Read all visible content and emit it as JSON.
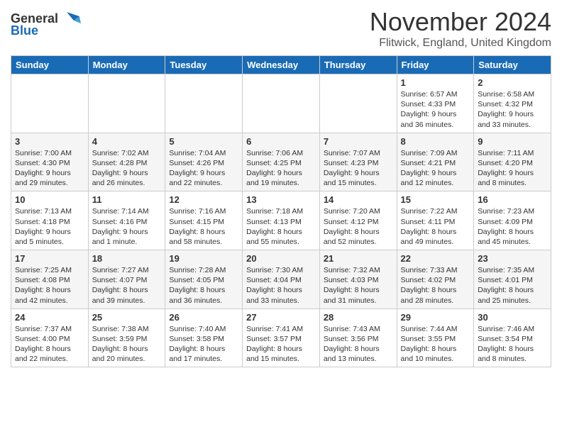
{
  "header": {
    "logo": {
      "general": "General",
      "blue": "Blue"
    },
    "title": "November 2024",
    "location": "Flitwick, England, United Kingdom"
  },
  "weekdays": [
    "Sunday",
    "Monday",
    "Tuesday",
    "Wednesday",
    "Thursday",
    "Friday",
    "Saturday"
  ],
  "weeks": [
    [
      {
        "day": "",
        "info": ""
      },
      {
        "day": "",
        "info": ""
      },
      {
        "day": "",
        "info": ""
      },
      {
        "day": "",
        "info": ""
      },
      {
        "day": "",
        "info": ""
      },
      {
        "day": "1",
        "info": "Sunrise: 6:57 AM\nSunset: 4:33 PM\nDaylight: 9 hours and 36 minutes."
      },
      {
        "day": "2",
        "info": "Sunrise: 6:58 AM\nSunset: 4:32 PM\nDaylight: 9 hours and 33 minutes."
      }
    ],
    [
      {
        "day": "3",
        "info": "Sunrise: 7:00 AM\nSunset: 4:30 PM\nDaylight: 9 hours and 29 minutes."
      },
      {
        "day": "4",
        "info": "Sunrise: 7:02 AM\nSunset: 4:28 PM\nDaylight: 9 hours and 26 minutes."
      },
      {
        "day": "5",
        "info": "Sunrise: 7:04 AM\nSunset: 4:26 PM\nDaylight: 9 hours and 22 minutes."
      },
      {
        "day": "6",
        "info": "Sunrise: 7:06 AM\nSunset: 4:25 PM\nDaylight: 9 hours and 19 minutes."
      },
      {
        "day": "7",
        "info": "Sunrise: 7:07 AM\nSunset: 4:23 PM\nDaylight: 9 hours and 15 minutes."
      },
      {
        "day": "8",
        "info": "Sunrise: 7:09 AM\nSunset: 4:21 PM\nDaylight: 9 hours and 12 minutes."
      },
      {
        "day": "9",
        "info": "Sunrise: 7:11 AM\nSunset: 4:20 PM\nDaylight: 9 hours and 8 minutes."
      }
    ],
    [
      {
        "day": "10",
        "info": "Sunrise: 7:13 AM\nSunset: 4:18 PM\nDaylight: 9 hours and 5 minutes."
      },
      {
        "day": "11",
        "info": "Sunrise: 7:14 AM\nSunset: 4:16 PM\nDaylight: 9 hours and 1 minute."
      },
      {
        "day": "12",
        "info": "Sunrise: 7:16 AM\nSunset: 4:15 PM\nDaylight: 8 hours and 58 minutes."
      },
      {
        "day": "13",
        "info": "Sunrise: 7:18 AM\nSunset: 4:13 PM\nDaylight: 8 hours and 55 minutes."
      },
      {
        "day": "14",
        "info": "Sunrise: 7:20 AM\nSunset: 4:12 PM\nDaylight: 8 hours and 52 minutes."
      },
      {
        "day": "15",
        "info": "Sunrise: 7:22 AM\nSunset: 4:11 PM\nDaylight: 8 hours and 49 minutes."
      },
      {
        "day": "16",
        "info": "Sunrise: 7:23 AM\nSunset: 4:09 PM\nDaylight: 8 hours and 45 minutes."
      }
    ],
    [
      {
        "day": "17",
        "info": "Sunrise: 7:25 AM\nSunset: 4:08 PM\nDaylight: 8 hours and 42 minutes."
      },
      {
        "day": "18",
        "info": "Sunrise: 7:27 AM\nSunset: 4:07 PM\nDaylight: 8 hours and 39 minutes."
      },
      {
        "day": "19",
        "info": "Sunrise: 7:28 AM\nSunset: 4:05 PM\nDaylight: 8 hours and 36 minutes."
      },
      {
        "day": "20",
        "info": "Sunrise: 7:30 AM\nSunset: 4:04 PM\nDaylight: 8 hours and 33 minutes."
      },
      {
        "day": "21",
        "info": "Sunrise: 7:32 AM\nSunset: 4:03 PM\nDaylight: 8 hours and 31 minutes."
      },
      {
        "day": "22",
        "info": "Sunrise: 7:33 AM\nSunset: 4:02 PM\nDaylight: 8 hours and 28 minutes."
      },
      {
        "day": "23",
        "info": "Sunrise: 7:35 AM\nSunset: 4:01 PM\nDaylight: 8 hours and 25 minutes."
      }
    ],
    [
      {
        "day": "24",
        "info": "Sunrise: 7:37 AM\nSunset: 4:00 PM\nDaylight: 8 hours and 22 minutes."
      },
      {
        "day": "25",
        "info": "Sunrise: 7:38 AM\nSunset: 3:59 PM\nDaylight: 8 hours and 20 minutes."
      },
      {
        "day": "26",
        "info": "Sunrise: 7:40 AM\nSunset: 3:58 PM\nDaylight: 8 hours and 17 minutes."
      },
      {
        "day": "27",
        "info": "Sunrise: 7:41 AM\nSunset: 3:57 PM\nDaylight: 8 hours and 15 minutes."
      },
      {
        "day": "28",
        "info": "Sunrise: 7:43 AM\nSunset: 3:56 PM\nDaylight: 8 hours and 13 minutes."
      },
      {
        "day": "29",
        "info": "Sunrise: 7:44 AM\nSunset: 3:55 PM\nDaylight: 8 hours and 10 minutes."
      },
      {
        "day": "30",
        "info": "Sunrise: 7:46 AM\nSunset: 3:54 PM\nDaylight: 8 hours and 8 minutes."
      }
    ]
  ]
}
